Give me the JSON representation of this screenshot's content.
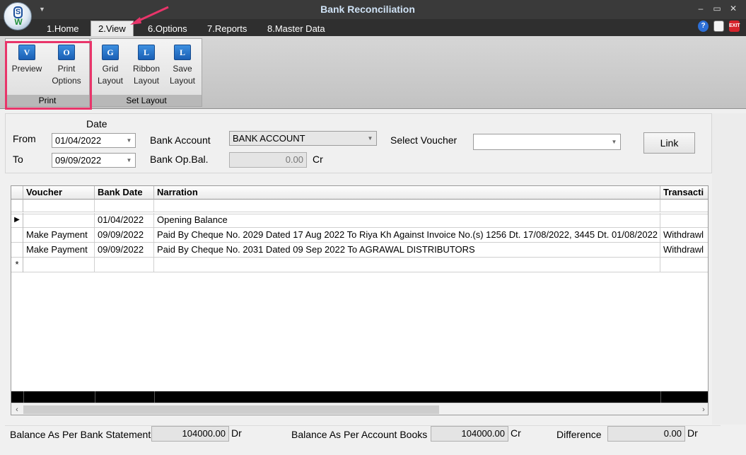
{
  "window": {
    "title": "Bank Reconciliation",
    "logo_letter_top": "S",
    "logo_letter_bottom": "W"
  },
  "tabs": [
    {
      "label": "1.Home"
    },
    {
      "label": "2.View"
    },
    {
      "label": "6.Options"
    },
    {
      "label": "7.Reports"
    },
    {
      "label": "8.Master Data"
    }
  ],
  "ribbon": {
    "print_group": {
      "label": "Print",
      "preview": {
        "label1": "Preview",
        "label2": "",
        "glyph": "V"
      },
      "print_options": {
        "label1": "Print",
        "label2": "Options",
        "glyph": "O"
      }
    },
    "layout_group": {
      "label": "Set Layout",
      "grid": {
        "label1": "Grid",
        "label2": "Layout",
        "glyph": "G"
      },
      "ribbon": {
        "label1": "Ribbon",
        "label2": "Layout",
        "glyph": "L"
      },
      "save": {
        "label1": "Save",
        "label2": "Layout",
        "glyph": "L"
      }
    }
  },
  "filters": {
    "date_heading": "Date",
    "from_label": "From",
    "from_value": "01/04/2022",
    "to_label": "To",
    "to_value": "09/09/2022",
    "bank_account_label": "Bank Account",
    "bank_account_value": "BANK ACCOUNT",
    "bank_opbal_label": "Bank Op.Bal.",
    "bank_opbal_value": "0.00",
    "bank_opbal_suffix": "Cr",
    "select_voucher_label": "Select Voucher",
    "select_voucher_value": "",
    "link_label": "Link"
  },
  "grid": {
    "columns": [
      "Voucher",
      "Bank Date",
      "Narration",
      "Transacti"
    ],
    "rows": [
      {
        "marker": "",
        "voucher": "",
        "bank_date": "",
        "narration": "",
        "transaction": ""
      },
      {
        "marker": "▶",
        "voucher": "",
        "bank_date": "01/04/2022",
        "narration": "Opening Balance",
        "transaction": ""
      },
      {
        "marker": "",
        "voucher": "Make Payment",
        "bank_date": "09/09/2022",
        "narration": "Paid By Cheque No. 2029 Dated 17 Aug 2022 To Riya Kh  Against Invoice No.(s) 1256 Dt. 17/08/2022, 3445 Dt. 01/08/2022",
        "transaction": "Withdrawl"
      },
      {
        "marker": "",
        "voucher": "Make Payment",
        "bank_date": "09/09/2022",
        "narration": "Paid By Cheque No. 2031 Dated 09 Sep 2022 To AGRAWAL DISTRIBUTORS",
        "transaction": "Withdrawl"
      },
      {
        "marker": "*",
        "voucher": "",
        "bank_date": "",
        "narration": "",
        "transaction": ""
      }
    ]
  },
  "footer": {
    "bank_stmt_label": "Balance As Per Bank Statement",
    "bank_stmt_value": "104000.00",
    "bank_stmt_suffix": "Dr",
    "books_label": "Balance As Per Account Books",
    "books_value": "104000.00",
    "books_suffix": "Cr",
    "diff_label": "Difference",
    "diff_value": "0.00",
    "diff_suffix": "Dr"
  },
  "colors": {
    "highlight": "#e8356a",
    "titlebar": "#3a3a3a",
    "accent_blue": "#1a5fb4"
  }
}
